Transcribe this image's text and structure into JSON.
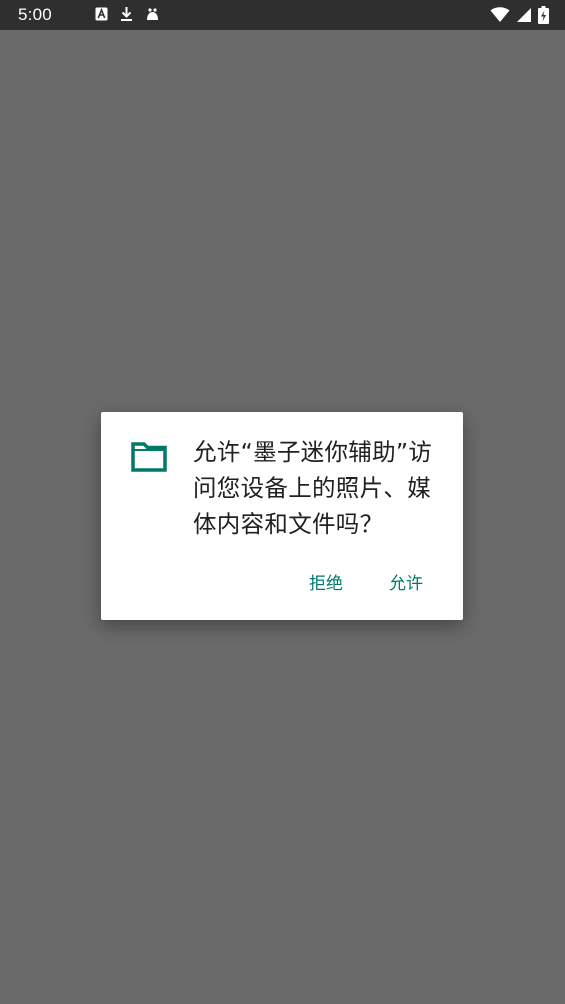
{
  "status_bar": {
    "time": "5:00",
    "left_icons": [
      "text-a-icon",
      "download-icon",
      "app-notification-icon"
    ],
    "right_icons": [
      "wifi-icon",
      "signal-icon",
      "battery-charging-icon"
    ]
  },
  "dialog": {
    "icon": "folder-icon",
    "message": "允许“墨子迷你辅助”访问您设备上的照片、媒体内容和文件吗？",
    "deny_label": "拒绝",
    "allow_label": "允许"
  },
  "colors": {
    "scrim": "#6a6a6a",
    "status_bar": "#2f2f2f",
    "accent": "#00796b"
  }
}
